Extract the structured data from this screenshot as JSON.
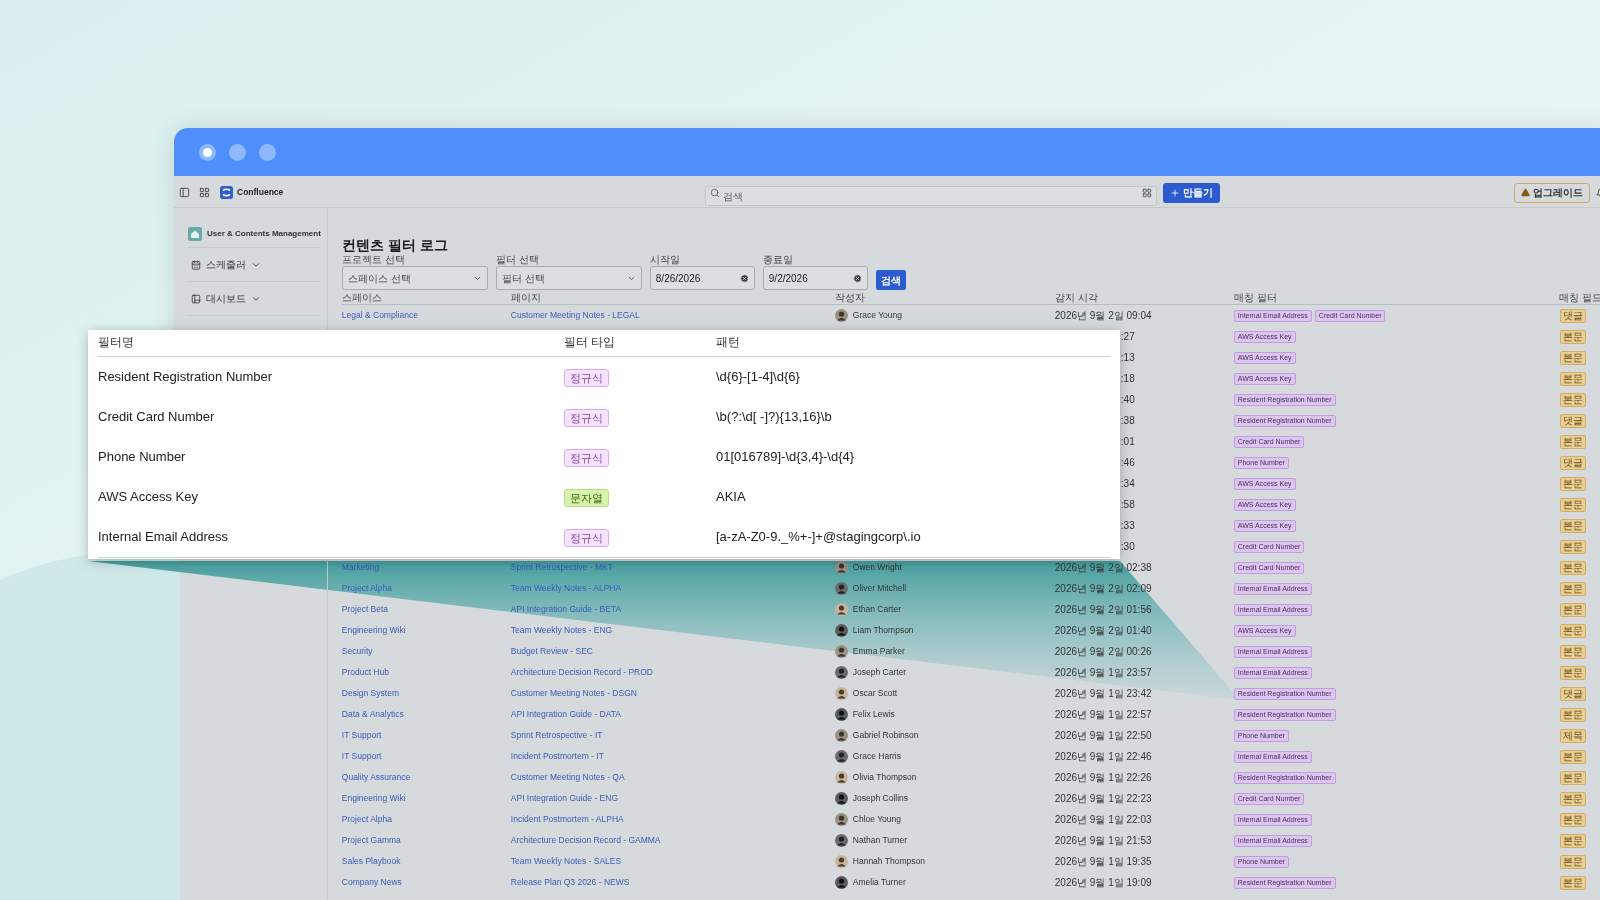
{
  "window_controls": [
    {
      "kind": "active"
    },
    {
      "kind": "plain"
    },
    {
      "kind": "plain"
    }
  ],
  "toolbar": {
    "app_name": "Confluence",
    "search_placeholder": "검색",
    "create_button": "만들기",
    "upgrade_button": "업그레이드"
  },
  "sidebar": {
    "space_name": "User & Contents Management",
    "items": [
      {
        "label": "스케줄러"
      },
      {
        "label": "대시보드"
      }
    ]
  },
  "page": {
    "title": "컨텐츠 필터 로그",
    "search_button": "검색",
    "filters": [
      {
        "label": "프로젝트 선택",
        "kind": "select",
        "placeholder": "스페이스 선택"
      },
      {
        "label": "필터 선택",
        "kind": "select",
        "placeholder": "필터 선택"
      },
      {
        "label": "시작일",
        "kind": "date",
        "value": "8/26/2026"
      },
      {
        "label": "종료일",
        "kind": "date",
        "value": "9/2/2026"
      }
    ]
  },
  "table": {
    "columns": [
      "스페이스",
      "페이지",
      "작성자",
      "감지 시각",
      "매칭 필터",
      "매칭 필드"
    ],
    "rows": [
      {
        "kind": "full",
        "space": "Legal & Compliance",
        "page": "Customer Meeting Notes - LEGAL",
        "author": "Grace Young",
        "time": "2026년 9월 2일 09:04",
        "filters": [
          "Internal Email Address",
          "Credit Card Number"
        ],
        "field": "댓글"
      },
      {
        "kind": "partial",
        "time": ":27",
        "filters": [
          "AWS Access Key"
        ],
        "field": "본문"
      },
      {
        "kind": "partial",
        "time": ":13",
        "filters": [
          "AWS Access Key"
        ],
        "field": "본문"
      },
      {
        "kind": "partial",
        "time": ":18",
        "filters": [
          "AWS Access Key"
        ],
        "field": "본문"
      },
      {
        "kind": "partial",
        "time": ":40",
        "filters": [
          "Resident Registration Number"
        ],
        "field": "본문"
      },
      {
        "kind": "partial",
        "time": ":38",
        "filters": [
          "Resident Registration Number"
        ],
        "field": "댓글"
      },
      {
        "kind": "partial",
        "time": ":01",
        "filters": [
          "Credit Card Number"
        ],
        "field": "본문"
      },
      {
        "kind": "partial",
        "time": ":46",
        "filters": [
          "Phone Number"
        ],
        "field": "댓글"
      },
      {
        "kind": "partial",
        "time": ":34",
        "filters": [
          "AWS Access Key"
        ],
        "field": "본문"
      },
      {
        "kind": "partial",
        "time": ":58",
        "filters": [
          "AWS Access Key"
        ],
        "field": "본문"
      },
      {
        "kind": "partial",
        "time": ":33",
        "filters": [
          "AWS Access Key"
        ],
        "field": "본문"
      },
      {
        "kind": "partial",
        "time": ":30",
        "filters": [
          "Credit Card Number"
        ],
        "field": "본문"
      },
      {
        "kind": "full",
        "space": "Marketing",
        "page": "Sprint Retrospective - MKT",
        "author": "Owen Wright",
        "time": "2026년 9월 2일 02:38",
        "filters": [
          "Credit Card Number"
        ],
        "field": "본문"
      },
      {
        "kind": "full",
        "space": "Project Alpha",
        "page": "Team Weekly Notes - ALPHA",
        "author": "Oliver Mitchell",
        "time": "2026년 9월 2일 02:09",
        "filters": [
          "Internal Email Address"
        ],
        "field": "본문"
      },
      {
        "kind": "full",
        "space": "Project Beta",
        "page": "API Integration Guide - BETA",
        "author": "Ethan Carter",
        "time": "2026년 9월 2일 01:56",
        "filters": [
          "Internal Email Address"
        ],
        "field": "본문"
      },
      {
        "kind": "full",
        "space": "Engineering Wiki",
        "page": "Team Weekly Notes - ENG",
        "author": "Liam Thompson",
        "time": "2026년 9월 2일 01:40",
        "filters": [
          "AWS Access Key"
        ],
        "field": "본문"
      },
      {
        "kind": "full",
        "space": "Security",
        "page": "Budget Review - SEC",
        "author": "Emma Parker",
        "time": "2026년 9월 2일 00:26",
        "filters": [
          "Internal Email Address"
        ],
        "field": "본문"
      },
      {
        "kind": "full",
        "space": "Product Hub",
        "page": "Architecture Decision Record - PROD",
        "author": "Joseph Carter",
        "time": "2026년 9월 1일 23:57",
        "filters": [
          "Internal Email Address"
        ],
        "field": "본문"
      },
      {
        "kind": "full",
        "space": "Design System",
        "page": "Customer Meeting Notes - DSGN",
        "author": "Oscar Scott",
        "time": "2026년 9월 1일 23:42",
        "filters": [
          "Resident Registration Number"
        ],
        "field": "댓글"
      },
      {
        "kind": "full",
        "space": "Data & Analytics",
        "page": "API Integration Guide - DATA",
        "author": "Felix Lewis",
        "time": "2026년 9월 1일 22:57",
        "filters": [
          "Resident Registration Number"
        ],
        "field": "본문"
      },
      {
        "kind": "full",
        "space": "IT Support",
        "page": "Sprint Retrospective - IT",
        "author": "Gabriel Robinson",
        "time": "2026년 9월 1일 22:50",
        "filters": [
          "Phone Number"
        ],
        "field": "제목"
      },
      {
        "kind": "full",
        "space": "IT Support",
        "page": "Incident Postmortem - IT",
        "author": "Grace Harris",
        "time": "2026년 9월 1일 22:46",
        "filters": [
          "Internal Email Address"
        ],
        "field": "본문"
      },
      {
        "kind": "full",
        "space": "Quality Assurance",
        "page": "Customer Meeting Notes - QA",
        "author": "Olivia Thompson",
        "time": "2026년 9월 1일 22:26",
        "filters": [
          "Resident Registration Number"
        ],
        "field": "본문"
      },
      {
        "kind": "full",
        "space": "Engineering Wiki",
        "page": "API Integration Guide - ENG",
        "author": "Joseph Collins",
        "time": "2026년 9월 1일 22:23",
        "filters": [
          "Credit Card Number"
        ],
        "field": "본문"
      },
      {
        "kind": "full",
        "space": "Project Alpha",
        "page": "Incident Postmortem - ALPHA",
        "author": "Chloe Young",
        "time": "2026년 9월 1일 22:03",
        "filters": [
          "Internal Email Address"
        ],
        "field": "본문"
      },
      {
        "kind": "full",
        "space": "Project Gamma",
        "page": "Architecture Decision Record - GAMMA",
        "author": "Nathan Turner",
        "time": "2026년 9월 1일 21:53",
        "filters": [
          "Internal Email Address"
        ],
        "field": "본문"
      },
      {
        "kind": "full",
        "space": "Sales Playbook",
        "page": "Team Weekly Notes - SALES",
        "author": "Hannah Thompson",
        "time": "2026년 9월 1일 19:35",
        "filters": [
          "Phone Number"
        ],
        "field": "본문"
      },
      {
        "kind": "full",
        "space": "Company News",
        "page": "Release Plan Q3 2026 - NEWS",
        "author": "Amelia Turner",
        "time": "2026년 9월 1일 19:09",
        "filters": [
          "Resident Registration Number"
        ],
        "field": "본문"
      }
    ]
  },
  "popup": {
    "columns": [
      "필터명",
      "필터 타입",
      "패턴"
    ],
    "rows": [
      {
        "name": "Resident Registration Number",
        "type": "정규식",
        "kind": "regex",
        "pattern": "\\d{6}-[1-4]\\d{6}"
      },
      {
        "name": "Credit Card Number",
        "type": "정규식",
        "kind": "regex",
        "pattern": "\\b(?:\\d[ -]?){13,16}\\b"
      },
      {
        "name": "Phone Number",
        "type": "정규식",
        "kind": "regex",
        "pattern": "01[016789]-\\d{3,4}-\\d{4}"
      },
      {
        "name": "AWS Access Key",
        "type": "문자열",
        "kind": "string",
        "pattern": "AKIA"
      },
      {
        "name": "Internal Email Address",
        "type": "정규식",
        "kind": "regex",
        "pattern": "[a-zA-Z0-9._%+-]+@stagingcorp\\.io"
      }
    ]
  }
}
